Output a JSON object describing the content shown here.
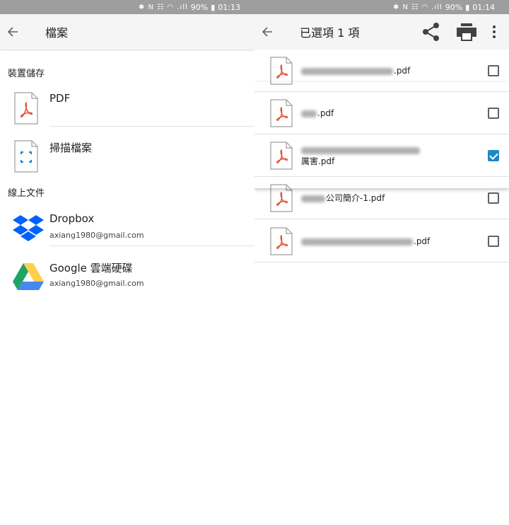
{
  "status_left": {
    "battery": "90%",
    "time": "01:13",
    "icons": "✱ N ☷ ◠ .ıll"
  },
  "status_right": {
    "battery": "90%",
    "time": "01:14",
    "icons": "✱ N ☷ ◠ .ıll"
  },
  "left": {
    "title": "檔案",
    "section_device": "裝置儲存",
    "section_online": "線上文件",
    "device_items": [
      {
        "title": "PDF",
        "icon": "pdf-file-icon"
      },
      {
        "title": "掃描檔案",
        "icon": "scan-file-icon"
      }
    ],
    "online_items": [
      {
        "title": "Dropbox",
        "subtitle": "axiang1980@gmail.com",
        "icon": "dropbox-icon"
      },
      {
        "title": "Google 雲端硬碟",
        "subtitle": "axiang1980@gmail.com",
        "icon": "google-drive-icon"
      }
    ]
  },
  "right": {
    "title": "已選項 1 項",
    "files": [
      {
        "name_visible": ".pdf",
        "checked": false
      },
      {
        "name_visible": ".pdf",
        "checked": false
      },
      {
        "name_visible": "厲害.pdf",
        "checked": true
      },
      {
        "name_visible": "公司簡介-1.pdf",
        "checked": false
      },
      {
        "name_visible": ".pdf",
        "checked": false
      }
    ]
  },
  "colors": {
    "pdf_red": "#e5533d",
    "check_blue": "#1e88c7",
    "dropbox_blue": "#0061fe",
    "drive_green": "#1fa463",
    "drive_yellow": "#ffd04b",
    "drive_blue": "#4688f1"
  }
}
